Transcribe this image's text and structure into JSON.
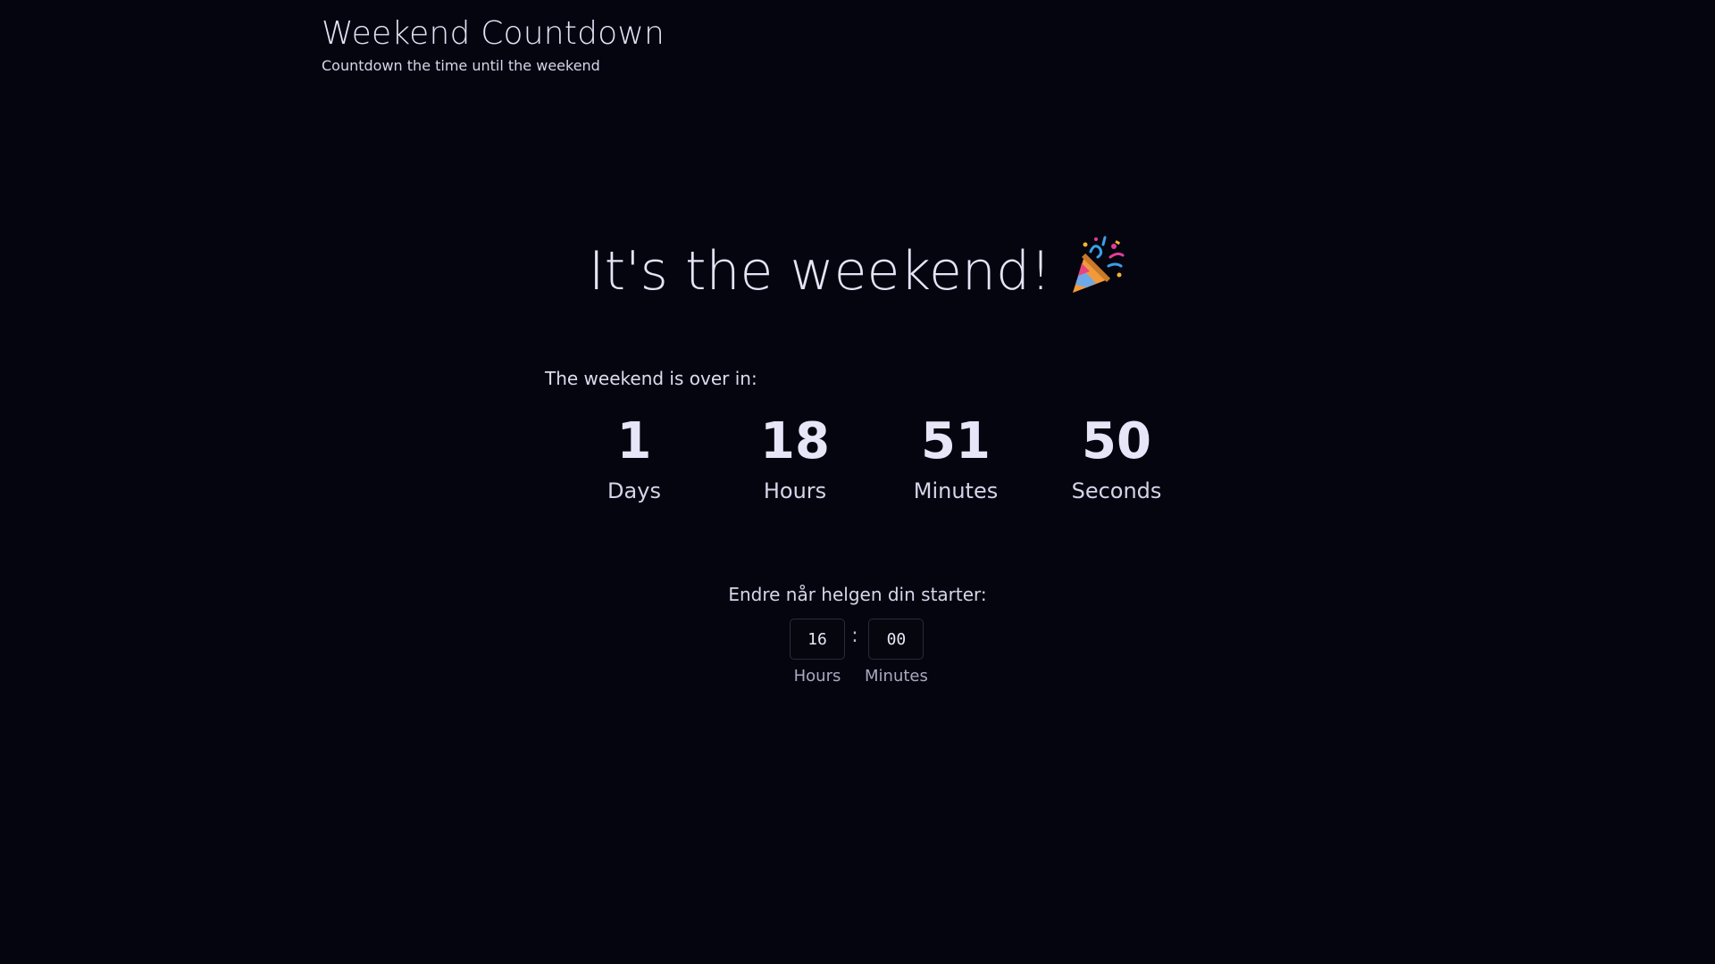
{
  "header": {
    "title": "Weekend Countdown",
    "subtitle": "Countdown the time until the weekend"
  },
  "headline": {
    "text": "It's the weekend!",
    "icon": "party-popper-icon"
  },
  "countdown": {
    "label": "The weekend is over in:",
    "units": [
      {
        "value": "1",
        "label": "Days"
      },
      {
        "value": "18",
        "label": "Hours"
      },
      {
        "value": "51",
        "label": "Minutes"
      },
      {
        "value": "50",
        "label": "Seconds"
      }
    ]
  },
  "start_time": {
    "label": "Endre når helgen din starter:",
    "separator": ":",
    "hours": {
      "value": "16",
      "label": "Hours"
    },
    "minutes": {
      "value": "00",
      "label": "Minutes"
    }
  },
  "colors": {
    "background": "#05050f",
    "text": "#dcdcf2",
    "input_border": "#2a2a3c"
  }
}
